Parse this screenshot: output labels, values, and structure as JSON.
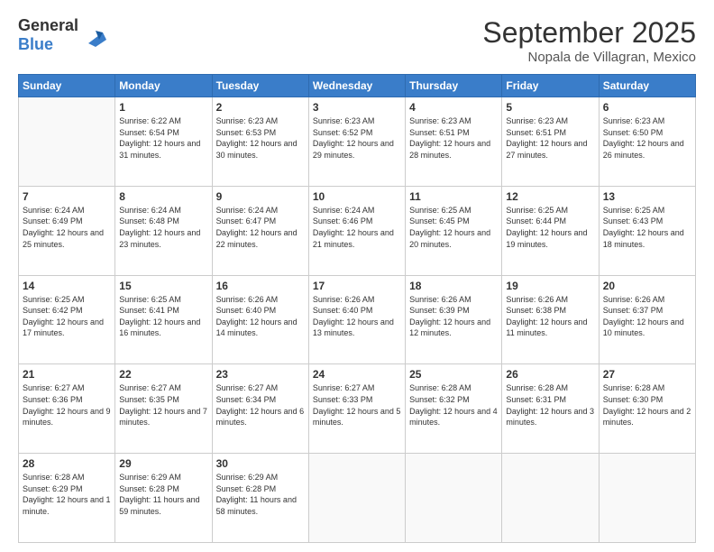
{
  "header": {
    "logo_line1": "General",
    "logo_line2": "Blue",
    "month_title": "September 2025",
    "subtitle": "Nopala de Villagran, Mexico"
  },
  "days_of_week": [
    "Sunday",
    "Monday",
    "Tuesday",
    "Wednesday",
    "Thursday",
    "Friday",
    "Saturday"
  ],
  "weeks": [
    [
      {
        "day": "",
        "empty": true
      },
      {
        "day": "1",
        "rise": "6:22 AM",
        "set": "6:54 PM",
        "daylight": "12 hours and 31 minutes."
      },
      {
        "day": "2",
        "rise": "6:23 AM",
        "set": "6:53 PM",
        "daylight": "12 hours and 30 minutes."
      },
      {
        "day": "3",
        "rise": "6:23 AM",
        "set": "6:52 PM",
        "daylight": "12 hours and 29 minutes."
      },
      {
        "day": "4",
        "rise": "6:23 AM",
        "set": "6:51 PM",
        "daylight": "12 hours and 28 minutes."
      },
      {
        "day": "5",
        "rise": "6:23 AM",
        "set": "6:51 PM",
        "daylight": "12 hours and 27 minutes."
      },
      {
        "day": "6",
        "rise": "6:23 AM",
        "set": "6:50 PM",
        "daylight": "12 hours and 26 minutes."
      }
    ],
    [
      {
        "day": "7",
        "rise": "6:24 AM",
        "set": "6:49 PM",
        "daylight": "12 hours and 25 minutes."
      },
      {
        "day": "8",
        "rise": "6:24 AM",
        "set": "6:48 PM",
        "daylight": "12 hours and 23 minutes."
      },
      {
        "day": "9",
        "rise": "6:24 AM",
        "set": "6:47 PM",
        "daylight": "12 hours and 22 minutes."
      },
      {
        "day": "10",
        "rise": "6:24 AM",
        "set": "6:46 PM",
        "daylight": "12 hours and 21 minutes."
      },
      {
        "day": "11",
        "rise": "6:25 AM",
        "set": "6:45 PM",
        "daylight": "12 hours and 20 minutes."
      },
      {
        "day": "12",
        "rise": "6:25 AM",
        "set": "6:44 PM",
        "daylight": "12 hours and 19 minutes."
      },
      {
        "day": "13",
        "rise": "6:25 AM",
        "set": "6:43 PM",
        "daylight": "12 hours and 18 minutes."
      }
    ],
    [
      {
        "day": "14",
        "rise": "6:25 AM",
        "set": "6:42 PM",
        "daylight": "12 hours and 17 minutes."
      },
      {
        "day": "15",
        "rise": "6:25 AM",
        "set": "6:41 PM",
        "daylight": "12 hours and 16 minutes."
      },
      {
        "day": "16",
        "rise": "6:26 AM",
        "set": "6:40 PM",
        "daylight": "12 hours and 14 minutes."
      },
      {
        "day": "17",
        "rise": "6:26 AM",
        "set": "6:40 PM",
        "daylight": "12 hours and 13 minutes."
      },
      {
        "day": "18",
        "rise": "6:26 AM",
        "set": "6:39 PM",
        "daylight": "12 hours and 12 minutes."
      },
      {
        "day": "19",
        "rise": "6:26 AM",
        "set": "6:38 PM",
        "daylight": "12 hours and 11 minutes."
      },
      {
        "day": "20",
        "rise": "6:26 AM",
        "set": "6:37 PM",
        "daylight": "12 hours and 10 minutes."
      }
    ],
    [
      {
        "day": "21",
        "rise": "6:27 AM",
        "set": "6:36 PM",
        "daylight": "12 hours and 9 minutes."
      },
      {
        "day": "22",
        "rise": "6:27 AM",
        "set": "6:35 PM",
        "daylight": "12 hours and 7 minutes."
      },
      {
        "day": "23",
        "rise": "6:27 AM",
        "set": "6:34 PM",
        "daylight": "12 hours and 6 minutes."
      },
      {
        "day": "24",
        "rise": "6:27 AM",
        "set": "6:33 PM",
        "daylight": "12 hours and 5 minutes."
      },
      {
        "day": "25",
        "rise": "6:28 AM",
        "set": "6:32 PM",
        "daylight": "12 hours and 4 minutes."
      },
      {
        "day": "26",
        "rise": "6:28 AM",
        "set": "6:31 PM",
        "daylight": "12 hours and 3 minutes."
      },
      {
        "day": "27",
        "rise": "6:28 AM",
        "set": "6:30 PM",
        "daylight": "12 hours and 2 minutes."
      }
    ],
    [
      {
        "day": "28",
        "rise": "6:28 AM",
        "set": "6:29 PM",
        "daylight": "12 hours and 1 minute."
      },
      {
        "day": "29",
        "rise": "6:29 AM",
        "set": "6:28 PM",
        "daylight": "11 hours and 59 minutes."
      },
      {
        "day": "30",
        "rise": "6:29 AM",
        "set": "6:28 PM",
        "daylight": "11 hours and 58 minutes."
      },
      {
        "day": "",
        "empty": true
      },
      {
        "day": "",
        "empty": true
      },
      {
        "day": "",
        "empty": true
      },
      {
        "day": "",
        "empty": true
      }
    ]
  ]
}
